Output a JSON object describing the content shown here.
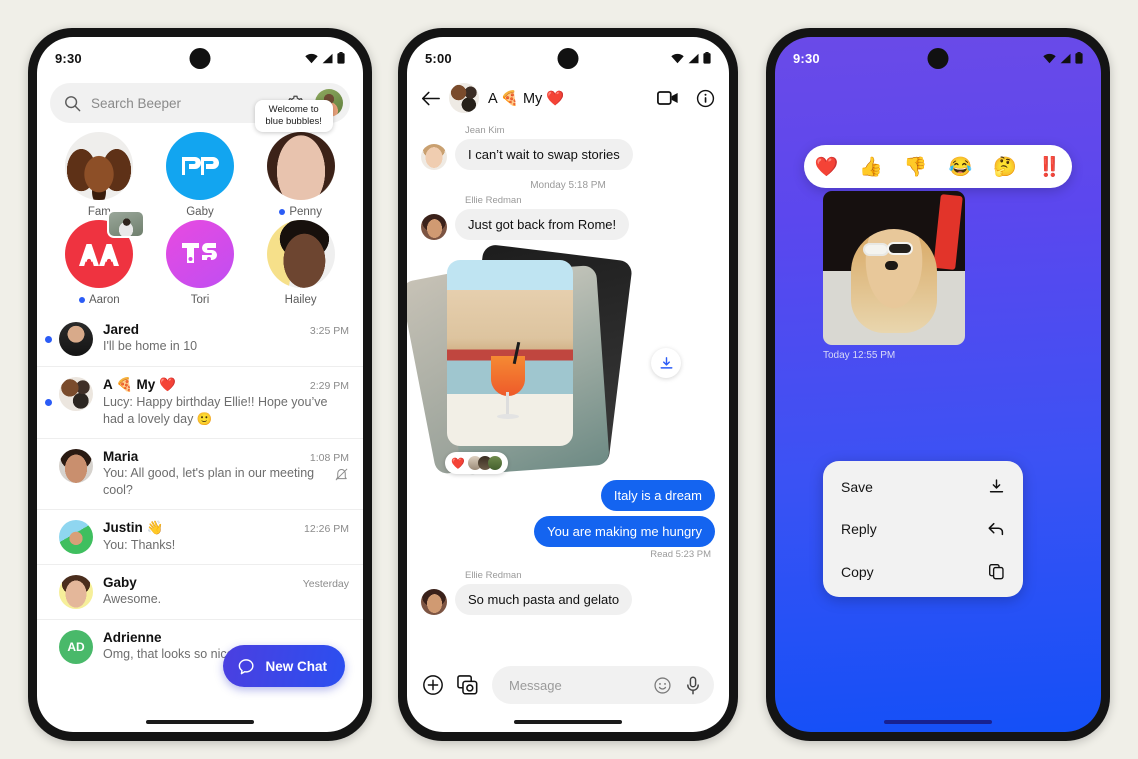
{
  "phone1": {
    "status": {
      "time": "9:30",
      "icons": [
        "wifi-icon",
        "signal-icon",
        "battery-icon"
      ]
    },
    "search": {
      "placeholder": "Search Beeper",
      "icon": "search-icon",
      "settings_icon": "gear-icon",
      "avatar": "profile-avatar"
    },
    "grid": [
      {
        "name": "Fam",
        "unread": false,
        "kind": "photo",
        "tooltip": null
      },
      {
        "name": "Gaby",
        "unread": false,
        "kind": "logo",
        "initials": "GB",
        "color": "#12a5f0",
        "tooltip": null
      },
      {
        "name": "Penny",
        "unread": true,
        "kind": "photo",
        "tooltip": "Welcome to blue bubbles!"
      },
      {
        "name": "Aaron",
        "unread": true,
        "kind": "logo",
        "initials": "AA",
        "color": "#ef3340",
        "badge": true,
        "tooltip": null
      },
      {
        "name": "Tori",
        "unread": false,
        "kind": "logo",
        "initials": "TS",
        "color": "#d44aea",
        "tooltip": null
      },
      {
        "name": "Hailey",
        "unread": false,
        "kind": "photo",
        "tooltip": null
      }
    ],
    "chats": [
      {
        "name": "Jared",
        "time": "3:25 PM",
        "preview": "I'll be home in 10",
        "unread": true,
        "muted": false,
        "avatar_kind": "photo",
        "avatar_color": "#2f3b47",
        "initials": "J"
      },
      {
        "name": "A 🍕 My ❤️",
        "time": "2:29 PM",
        "preview": "Lucy: Happy birthday Ellie!! Hope you’ve had a lovely day  🙂",
        "unread": true,
        "muted": false,
        "avatar_kind": "group",
        "avatar_color": "#ded6cd",
        "initials": ""
      },
      {
        "name": "Maria",
        "time": "1:08 PM",
        "preview": "You: All good, let's plan in our meeting cool?",
        "unread": false,
        "muted": true,
        "avatar_kind": "photo",
        "avatar_color": "#7a5f52",
        "initials": "M"
      },
      {
        "name": "Justin 👋",
        "time": "12:26 PM",
        "preview": "You: Thanks!",
        "unread": false,
        "muted": false,
        "avatar_kind": "photo",
        "avatar_color": "#3fbf5f",
        "initials": "J"
      },
      {
        "name": "Gaby",
        "time": "Yesterday",
        "preview": "Awesome.",
        "unread": false,
        "muted": false,
        "avatar_kind": "photo",
        "avatar_color": "#f3e07a",
        "initials": "G"
      },
      {
        "name": "Adrienne",
        "time": "",
        "preview": "Omg, that looks so nice!",
        "unread": false,
        "muted": false,
        "avatar_kind": "initials",
        "avatar_color": "#49b96a",
        "initials": "AD"
      }
    ],
    "fab": {
      "label": "New Chat",
      "icon": "chat-bubble-icon"
    }
  },
  "phone2": {
    "status": {
      "time": "5:00"
    },
    "header": {
      "title": "A 🍕 My ❤️",
      "back_icon": "back-arrow-icon",
      "video_icon": "video-call-icon",
      "info_icon": "info-icon"
    },
    "messages": [
      {
        "type": "in",
        "sender": "Jean Kim",
        "text": "I can’t wait to swap stories"
      },
      {
        "type": "daystamp",
        "text": "Monday 5:18 PM"
      },
      {
        "type": "in",
        "sender": "Ellie Redman",
        "text": "Just got back from Rome!"
      },
      {
        "type": "photos",
        "reaction": "❤️",
        "download_icon": "download-icon"
      },
      {
        "type": "out",
        "text": "Italy is a dream"
      },
      {
        "type": "out",
        "text": "You are making me hungry"
      },
      {
        "type": "readstamp",
        "text": "Read  5:23 PM"
      },
      {
        "type": "in",
        "sender": "Ellie Redman",
        "text": "So much pasta and gelato"
      }
    ],
    "composer": {
      "placeholder": "Message",
      "plus_icon": "plus-circle-icon",
      "gallery_icon": "photo-camera-icon",
      "emoji_icon": "emoji-icon",
      "mic_icon": "microphone-icon"
    }
  },
  "phone3": {
    "status": {
      "time": "9:30"
    },
    "reactions": [
      "❤️",
      "👍",
      "👎",
      "😂",
      "🤔",
      "‼️"
    ],
    "photo_caption": "Today  12:55 PM",
    "menu": [
      {
        "label": "Save",
        "icon": "download-icon"
      },
      {
        "label": "Reply",
        "icon": "reply-arrow-icon"
      },
      {
        "label": "Copy",
        "icon": "copy-icon"
      }
    ]
  },
  "colors": {
    "page_bg": "#f0efe8",
    "accent_blue": "#1464f0",
    "unread_dot": "#2b5cf6",
    "fab_gradient_start": "#4b3fe0",
    "fab_gradient_end": "#2b4ff0",
    "p3_gradient_start": "#6a4ae8",
    "p3_gradient_end": "#1450f7"
  }
}
